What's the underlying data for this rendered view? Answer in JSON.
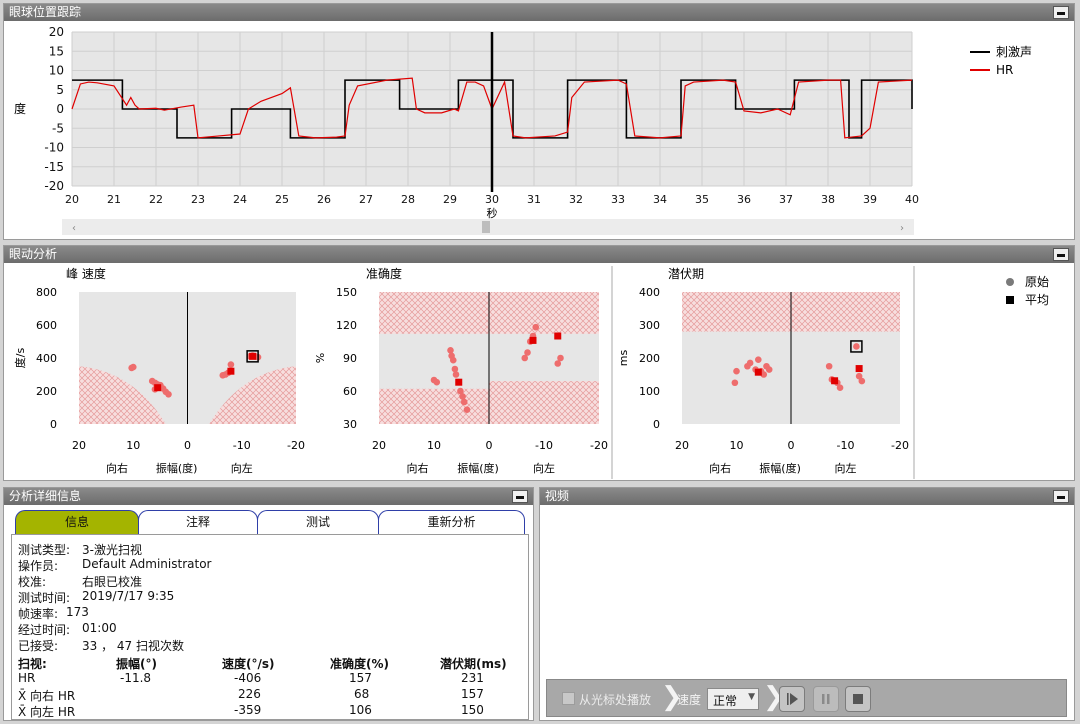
{
  "panels": {
    "tracking": {
      "title": "眼球位置跟踪"
    },
    "analysis": {
      "title": "眼动分析"
    },
    "details": {
      "title": "分析详细信息"
    },
    "video": {
      "title": "视频"
    }
  },
  "tracking_chart": {
    "type": "line",
    "xlabel": "秒",
    "ylabel": "度",
    "xlim": [
      20,
      40
    ],
    "ylim": [
      -20,
      20
    ],
    "xticks": [
      "20",
      "21",
      "22",
      "23",
      "24",
      "25",
      "26",
      "27",
      "28",
      "29",
      "30",
      "31",
      "32",
      "33",
      "34",
      "35",
      "36",
      "37",
      "38",
      "39",
      "40"
    ],
    "yticks": [
      "20",
      "15",
      "10",
      "5",
      "0",
      "-5",
      "-10",
      "-15",
      "-20"
    ],
    "cursor_x": 30,
    "legend": [
      {
        "name": "刺激声",
        "color": "#000000"
      },
      {
        "name": "HR",
        "color": "#e00000"
      }
    ],
    "stimulus": [
      [
        20,
        7.5
      ],
      [
        21.2,
        7.5
      ],
      [
        21.2,
        0
      ],
      [
        22.5,
        0
      ],
      [
        22.5,
        -7.5
      ],
      [
        23.8,
        -7.5
      ],
      [
        23.8,
        0
      ],
      [
        25.2,
        0
      ],
      [
        25.2,
        -7.5
      ],
      [
        26.5,
        -7.5
      ],
      [
        26.5,
        7.5
      ],
      [
        27.8,
        7.5
      ],
      [
        27.8,
        0
      ],
      [
        29.2,
        0
      ],
      [
        29.2,
        7.5
      ],
      [
        30.5,
        7.5
      ],
      [
        30.5,
        -7.5
      ],
      [
        31.8,
        -7.5
      ],
      [
        31.8,
        7.5
      ],
      [
        33.2,
        7.5
      ],
      [
        33.2,
        -7.5
      ],
      [
        34.5,
        -7.5
      ],
      [
        34.5,
        7.5
      ],
      [
        35.8,
        7.5
      ],
      [
        35.8,
        0
      ],
      [
        37.2,
        0
      ],
      [
        37.2,
        7.5
      ],
      [
        38.5,
        7.5
      ],
      [
        38.5,
        -7.5
      ],
      [
        38.8,
        -7.5
      ],
      [
        38.8,
        7.5
      ],
      [
        40,
        7.5
      ],
      [
        40,
        0
      ]
    ],
    "hr": [
      [
        20,
        0
      ],
      [
        20.2,
        6.5
      ],
      [
        20.4,
        7
      ],
      [
        20.6,
        6.8
      ],
      [
        21,
        6
      ],
      [
        21.3,
        1
      ],
      [
        21.4,
        3
      ],
      [
        21.5,
        1
      ],
      [
        21.6,
        0
      ],
      [
        22,
        0.2
      ],
      [
        22.2,
        -0.3
      ],
      [
        22.6,
        0.5
      ],
      [
        22.9,
        1
      ],
      [
        23,
        -7.5
      ],
      [
        23.5,
        -7
      ],
      [
        24,
        -6.5
      ],
      [
        24.2,
        0
      ],
      [
        24.5,
        2
      ],
      [
        25,
        4
      ],
      [
        25.2,
        5.5
      ],
      [
        25.4,
        -7
      ],
      [
        25.8,
        -7.5
      ],
      [
        26.3,
        -7.3
      ],
      [
        26.5,
        -7
      ],
      [
        26.6,
        1
      ],
      [
        26.8,
        6
      ],
      [
        27.5,
        7.5
      ],
      [
        28.1,
        8
      ],
      [
        28.2,
        0
      ],
      [
        28.4,
        -1
      ],
      [
        28.8,
        -1
      ],
      [
        29.1,
        0
      ],
      [
        29.2,
        -0.5
      ],
      [
        29.4,
        7
      ],
      [
        29.6,
        7
      ],
      [
        29.8,
        6
      ],
      [
        30,
        0
      ],
      [
        30.3,
        7
      ],
      [
        30.5,
        -7
      ],
      [
        30.8,
        -7.5
      ],
      [
        31.5,
        -7
      ],
      [
        31.8,
        -6
      ],
      [
        31.9,
        3
      ],
      [
        32.2,
        7
      ],
      [
        33,
        7.5
      ],
      [
        33.2,
        6.5
      ],
      [
        33.4,
        -7
      ],
      [
        34,
        -7.5
      ],
      [
        34.5,
        -7
      ],
      [
        34.6,
        6
      ],
      [
        34.8,
        7
      ],
      [
        35.5,
        7.5
      ],
      [
        35.8,
        7
      ],
      [
        36,
        -0.5
      ],
      [
        36.4,
        -1
      ],
      [
        36.8,
        0
      ],
      [
        37.1,
        -1.5
      ],
      [
        37.3,
        7
      ],
      [
        38,
        7.5
      ],
      [
        38.3,
        7.5
      ],
      [
        38.4,
        -7.5
      ],
      [
        38.8,
        -7
      ],
      [
        39,
        -5
      ],
      [
        39.2,
        7
      ],
      [
        40,
        7.5
      ]
    ]
  },
  "analysis": {
    "legend": [
      {
        "name": "原始",
        "marker": "dot"
      },
      {
        "name": "平均",
        "marker": "square"
      }
    ],
    "x_common": {
      "left": "向右",
      "center": "振幅(度)",
      "right": "向左"
    },
    "charts": [
      {
        "type": "scatter",
        "title": "峰 速度",
        "ylabel": "度/s",
        "yticks": [
          "800",
          "600",
          "400",
          "200",
          "0"
        ],
        "ylim": [
          0,
          800
        ],
        "xticks": [
          "20",
          "10",
          "0",
          "-10",
          "-20"
        ],
        "xlim": [
          20,
          -20
        ],
        "points": [
          [
            10.3,
            340
          ],
          [
            10,
            345
          ],
          [
            6.5,
            260
          ],
          [
            6,
            250
          ],
          [
            5.5,
            240
          ],
          [
            5,
            235
          ],
          [
            4.5,
            215
          ],
          [
            4,
            195
          ],
          [
            3.5,
            180
          ],
          [
            6,
            210
          ],
          [
            -6.5,
            295
          ],
          [
            -7,
            300
          ],
          [
            -7.5,
            310
          ],
          [
            -8,
            360
          ],
          [
            -11.5,
            410
          ],
          [
            -12,
            415
          ],
          [
            -12.5,
            410
          ],
          [
            -13,
            405
          ]
        ],
        "averages": [
          [
            5.5,
            220
          ],
          [
            -8,
            320
          ],
          [
            -12,
            410
          ]
        ],
        "highlight": [
          -12,
          410
        ]
      },
      {
        "type": "scatter",
        "title": "准确度",
        "ylabel": "%",
        "yticks": [
          "150",
          "120",
          "90",
          "60",
          "30"
        ],
        "ylim": [
          30,
          150
        ],
        "xticks": [
          "20",
          "10",
          "0",
          "-10",
          "-20"
        ],
        "xlim": [
          20,
          -20
        ],
        "points": [
          [
            10,
            70
          ],
          [
            9.5,
            68
          ],
          [
            7,
            97
          ],
          [
            6.8,
            92
          ],
          [
            6.5,
            88
          ],
          [
            6.2,
            80
          ],
          [
            6,
            75
          ],
          [
            5.5,
            68
          ],
          [
            5.2,
            60
          ],
          [
            4.8,
            55
          ],
          [
            4.5,
            50
          ],
          [
            4,
            43
          ],
          [
            -6.5,
            90
          ],
          [
            -7,
            95
          ],
          [
            -7.5,
            105
          ],
          [
            -8,
            110
          ],
          [
            -8.5,
            118
          ],
          [
            -12.5,
            85
          ],
          [
            -13,
            90
          ]
        ],
        "averages": [
          [
            5.5,
            68
          ],
          [
            -8,
            106
          ],
          [
            -12.5,
            110
          ]
        ],
        "highlight": null
      },
      {
        "type": "scatter",
        "title": "潜伏期",
        "ylabel": "ms",
        "yticks": [
          "400",
          "300",
          "200",
          "100",
          "0"
        ],
        "ylim": [
          0,
          400
        ],
        "xticks": [
          "20",
          "10",
          "0",
          "-10",
          "-20"
        ],
        "xlim": [
          20,
          -20
        ],
        "points": [
          [
            10,
            160
          ],
          [
            10.3,
            125
          ],
          [
            8,
            175
          ],
          [
            7.5,
            185
          ],
          [
            6.5,
            165
          ],
          [
            6,
            195
          ],
          [
            5.5,
            160
          ],
          [
            5,
            150
          ],
          [
            4.5,
            175
          ],
          [
            4,
            165
          ],
          [
            -7,
            175
          ],
          [
            -7.5,
            135
          ],
          [
            -8,
            130
          ],
          [
            -8.5,
            125
          ],
          [
            -9,
            110
          ],
          [
            -12.5,
            145
          ],
          [
            -13,
            130
          ],
          [
            -12,
            235
          ]
        ],
        "averages": [
          [
            6,
            157
          ],
          [
            -8,
            131
          ],
          [
            -12.5,
            168
          ]
        ],
        "highlight": [
          -12,
          235
        ]
      }
    ]
  },
  "details": {
    "tabs": [
      "信息",
      "注释",
      "测试",
      "重新分析"
    ],
    "rows": [
      {
        "k": "测试类型:",
        "v": "3-激光扫视"
      },
      {
        "k": "操作员:",
        "v": "Default Administrator"
      },
      {
        "k": "校准:",
        "v": "右眼已校准"
      },
      {
        "k": "测试时间:",
        "v": "2019/7/17 9:35"
      },
      {
        "k": "帧速率:",
        "v": "173"
      },
      {
        "k": "经过时间:",
        "v": "01:00"
      },
      {
        "k": "已接受:",
        "v": "33 ，  47 扫视次数"
      }
    ],
    "table": {
      "headers": [
        "扫视:",
        "振幅(°)",
        "速度(°/s)",
        "准确度(%)",
        "潜伏期(ms)"
      ],
      "rows": [
        [
          "HR",
          "-11.8",
          "-406",
          "157",
          "231"
        ],
        [
          "X̄ 向右 HR",
          "",
          "226",
          "68",
          "157"
        ],
        [
          "X̄ 向左 HR",
          "",
          "-359",
          "106",
          "150"
        ]
      ]
    }
  },
  "video": {
    "cursor_play_label": "从光标处播放",
    "speed_label": "速度",
    "speed_value": "正常"
  },
  "colors": {
    "stimulus": "#000000",
    "hr": "#e00000",
    "raw_point": "#ee6d6d",
    "avg_point": "#e00000",
    "selected_tab": "#a4b400"
  }
}
